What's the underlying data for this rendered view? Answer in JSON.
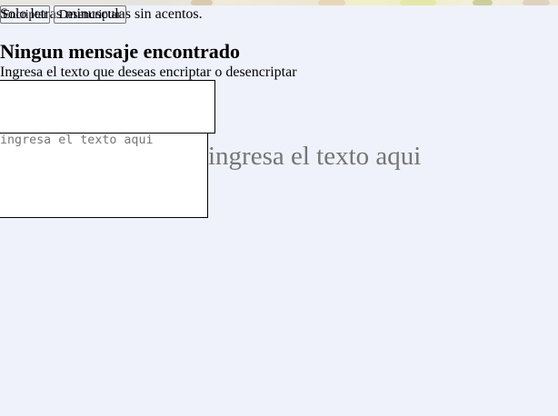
{
  "toolbar": {
    "hint": "Solo letras minusculas sin acentos.",
    "encrypt_label": "Encriptar",
    "decrypt_label": "Desencriptar"
  },
  "main": {
    "title": "Ningun mensaje encontrado",
    "subtitle": "Ingresa el texto que deseas encriptar o desencriptar"
  },
  "input": {
    "placeholder": "ingresa el texto aqui",
    "value": ""
  },
  "colors": {
    "background": "#f0f2fb",
    "placeholder": "#757575"
  }
}
